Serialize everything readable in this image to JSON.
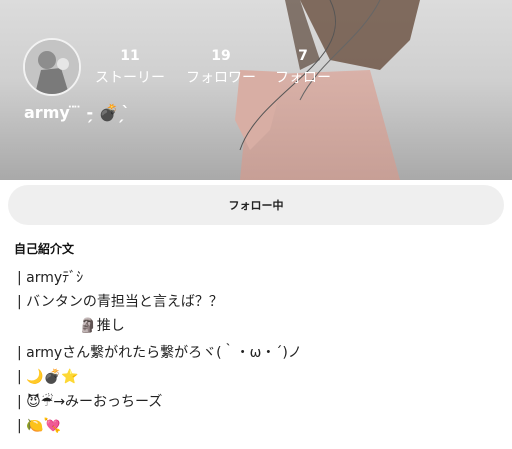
{
  "profile": {
    "username": "army ̈ ̈ ‑̗ 💣 ̗ ̀",
    "stats": [
      {
        "count": "11",
        "label": "ストーリー"
      },
      {
        "count": "19",
        "label": "フォロワー"
      },
      {
        "count": "7",
        "label": "フォロー"
      }
    ]
  },
  "actions": {
    "follow_label": "フォロー中"
  },
  "bio": {
    "heading": "自己紹介文",
    "lines": [
      "| armyﾃﾞｼ",
      "| バンタンの青担当と言えば？？",
      "              🗿推し",
      "| armyさん繋がれたら繋がろヾ(｀・ω・´)ノ",
      "| 🌙💣⭐️",
      "| 😈☔→みーおっちーズ",
      "| 🍋💘"
    ]
  },
  "colors": {
    "header_text": "#ffffff",
    "button_bg": "#efefef",
    "body_text": "#222222"
  }
}
